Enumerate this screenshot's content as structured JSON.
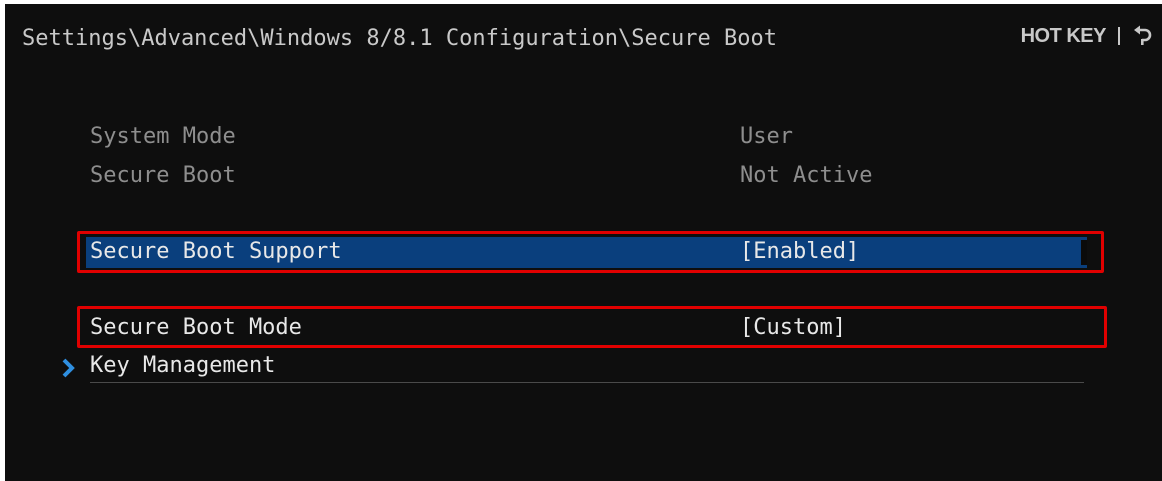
{
  "header": {
    "breadcrumb": "Settings\\Advanced\\Windows 8/8.1 Configuration\\Secure Boot",
    "hotkey_label": "HOT KEY",
    "back_icon": "back-arrow-icon"
  },
  "info_rows": [
    {
      "label": "System Mode",
      "value": "User"
    },
    {
      "label": "Secure Boot",
      "value": "Not Active"
    }
  ],
  "settings": {
    "secure_boot_support": {
      "label": "Secure Boot Support",
      "value": "[Enabled]"
    },
    "secure_boot_mode": {
      "label": "Secure Boot Mode",
      "value": "[Custom]"
    },
    "key_management": {
      "label": "Key Management",
      "icon": "chevron-right-icon"
    }
  },
  "colors": {
    "background": "#0e0e0e",
    "selection": "#0a3f7d",
    "highlight_box": "#e00000",
    "chevron": "#2f8fe0"
  }
}
